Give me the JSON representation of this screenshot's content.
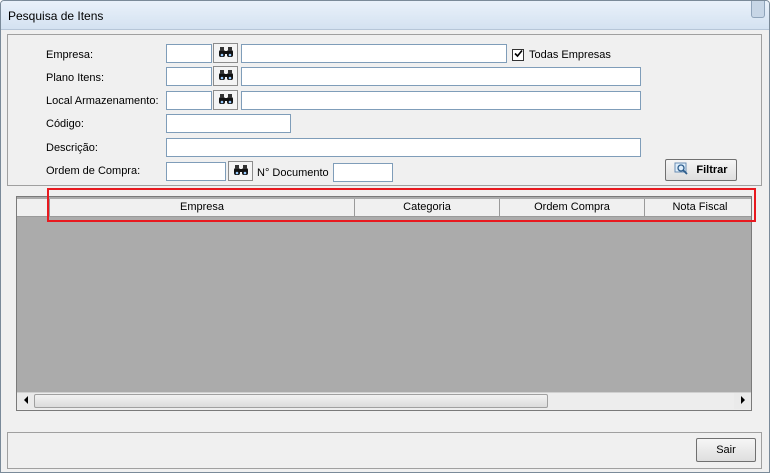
{
  "window": {
    "title": "Pesquisa de Itens"
  },
  "filters": {
    "empresa_label": "Empresa:",
    "plano_label": "Plano Itens:",
    "local_label": "Local Armazenamento:",
    "codigo_label": "Código:",
    "descricao_label": "Descrição:",
    "ordem_label": "Ordem de Compra:",
    "documento_label": "N° Documento",
    "todas_empresas_label": "Todas Empresas",
    "todas_empresas_checked": true,
    "filtrar_label": "Filtrar",
    "empresa_code": "",
    "empresa_name": "",
    "plano_code": "",
    "plano_name": "",
    "local_code": "",
    "local_name": "",
    "codigo_value": "",
    "descricao_value": "",
    "ordem_value": "",
    "documento_value": ""
  },
  "grid": {
    "columns": [
      "Empresa",
      "Categoria",
      "Ordem Compra",
      "Nota Fiscal"
    ],
    "rows": []
  },
  "footer": {
    "sair_label": "Sair"
  },
  "colors": {
    "highlight": "#e8191f",
    "grid_bg": "#ababab"
  }
}
